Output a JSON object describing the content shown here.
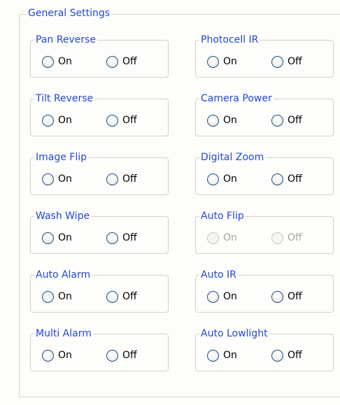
{
  "panel": {
    "title": "General Settings",
    "on_label": "On",
    "off_label": "Off",
    "groups": [
      {
        "label": "Pan Reverse",
        "enabled": true
      },
      {
        "label": "Photocell IR",
        "enabled": true
      },
      {
        "label": "Tilt Reverse",
        "enabled": true
      },
      {
        "label": "Camera Power",
        "enabled": true
      },
      {
        "label": "Image Flip",
        "enabled": true
      },
      {
        "label": "Digital Zoom",
        "enabled": true
      },
      {
        "label": "Wash Wipe",
        "enabled": true
      },
      {
        "label": "Auto Flip",
        "enabled": false
      },
      {
        "label": "Auto Alarm",
        "enabled": true
      },
      {
        "label": "Auto IR",
        "enabled": true
      },
      {
        "label": "Multi Alarm",
        "enabled": true
      },
      {
        "label": "Auto Lowlight",
        "enabled": true
      }
    ]
  }
}
